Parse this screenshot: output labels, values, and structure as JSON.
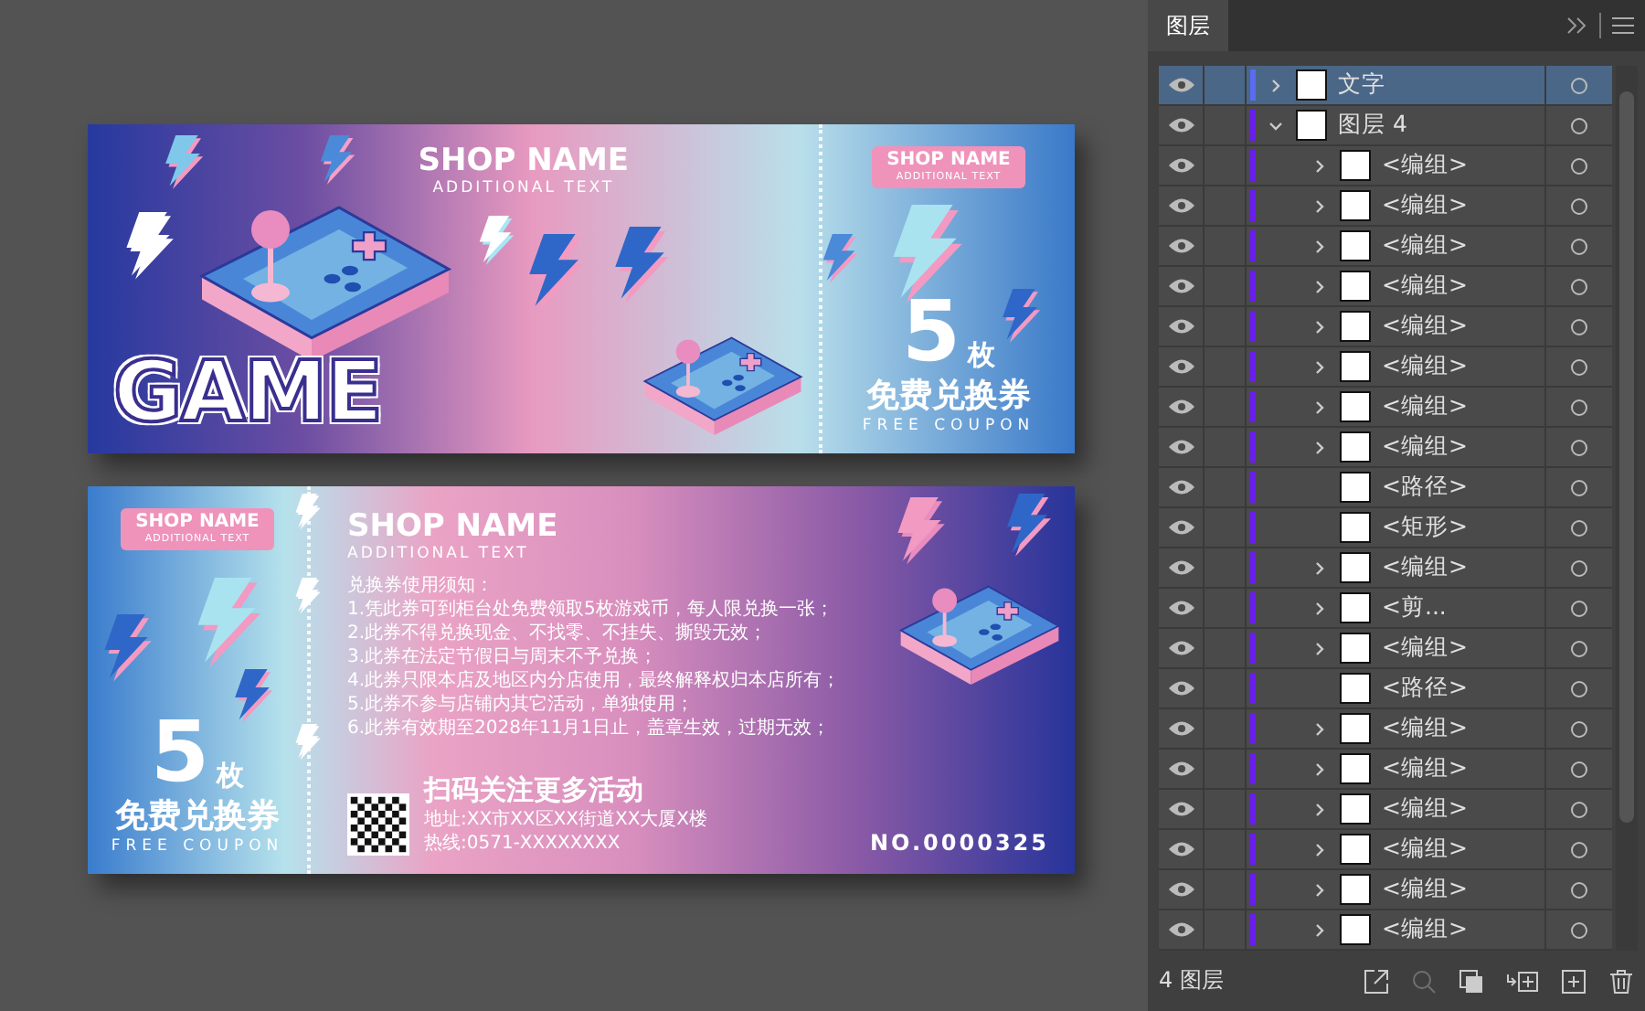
{
  "canvas": {
    "coupons": [
      {
        "kind": "stub-right",
        "shop_name": "SHOP NAME",
        "additional_text": "ADDITIONAL TEXT",
        "headline": "GAME",
        "stub": {
          "shop_name": "SHOP NAME",
          "additional_text": "ADDITIONAL TEXT",
          "count": "5",
          "unit": "枚",
          "title": "免费兑换券",
          "subtitle": "FREE COUPON"
        }
      },
      {
        "kind": "stub-left",
        "shop_name": "SHOP NAME",
        "additional_text": "ADDITIONAL TEXT",
        "stub": {
          "shop_name": "SHOP NAME",
          "additional_text": "ADDITIONAL TEXT",
          "count": "5",
          "unit": "枚",
          "title": "免费兑换券",
          "subtitle": "FREE COUPON"
        },
        "rules_title": "兑换券使用须知：",
        "rules": [
          "1.凭此券可到柜台处免费领取5枚游戏币，每人限兑换一张；",
          "2.此券不得兑换现金、不找零、不挂失、撕毁无效；",
          "3.此券在法定节假日与周末不予兑换；",
          "4.此券只限本店及地区内分店使用，最终解释权归本店所有；",
          "5.此券不参与店铺内其它活动，单独使用；",
          "6.此券有效期至2028年11月1日止，盖章生效，过期无效；"
        ],
        "qr_caption": "扫码关注更多活动",
        "address": "地址:XX市XX区XX街道XX大厦X楼",
        "hotline": "热线:0571-XXXXXXXX",
        "serial": "NO.0000325"
      }
    ]
  },
  "layers_panel": {
    "tab": {
      "label": "图层",
      "selected": true
    },
    "layers": [
      {
        "label": "文字",
        "kind": "group",
        "expanded": false,
        "selected": true,
        "visible": true,
        "color": "#5b6cf0"
      },
      {
        "label": "图层 4",
        "kind": "group",
        "expanded": true,
        "selected": false,
        "visible": true,
        "color": "#6a1df0",
        "children": [
          {
            "label": "<编组>",
            "kind": "group",
            "expanded": false,
            "selected": false,
            "visible": true
          },
          {
            "label": "<编组>",
            "kind": "group",
            "expanded": false,
            "selected": false,
            "visible": true
          },
          {
            "label": "<编组>",
            "kind": "group",
            "expanded": false,
            "selected": false,
            "visible": true
          },
          {
            "label": "<编组>",
            "kind": "group",
            "expanded": false,
            "selected": false,
            "visible": true
          },
          {
            "label": "<编组>",
            "kind": "group",
            "expanded": false,
            "selected": false,
            "visible": true
          },
          {
            "label": "<编组>",
            "kind": "group",
            "expanded": false,
            "selected": false,
            "visible": true
          },
          {
            "label": "<编组>",
            "kind": "group",
            "expanded": false,
            "selected": false,
            "visible": true
          },
          {
            "label": "<编组>",
            "kind": "group",
            "expanded": false,
            "selected": false,
            "visible": true
          },
          {
            "label": "<路径>",
            "kind": "shape",
            "selected": false,
            "visible": true
          },
          {
            "label": "<矩形>",
            "kind": "shape",
            "selected": false,
            "visible": true
          },
          {
            "label": "<编组>",
            "kind": "group",
            "expanded": false,
            "selected": false,
            "visible": true
          },
          {
            "label": "<剪...",
            "kind": "group",
            "expanded": false,
            "selected": false,
            "visible": true
          },
          {
            "label": "<编组>",
            "kind": "group",
            "expanded": false,
            "selected": false,
            "visible": true
          },
          {
            "label": "<路径>",
            "kind": "shape",
            "selected": false,
            "visible": true
          },
          {
            "label": "<编组>",
            "kind": "group",
            "expanded": false,
            "selected": false,
            "visible": true
          },
          {
            "label": "<编组>",
            "kind": "group",
            "expanded": false,
            "selected": false,
            "visible": true
          },
          {
            "label": "<编组>",
            "kind": "group",
            "expanded": false,
            "selected": false,
            "visible": true
          },
          {
            "label": "<编组>",
            "kind": "group",
            "expanded": false,
            "selected": false,
            "visible": true
          },
          {
            "label": "<编组>",
            "kind": "group",
            "expanded": false,
            "selected": false,
            "visible": true
          },
          {
            "label": "<编组>",
            "kind": "group",
            "expanded": false,
            "selected": false,
            "visible": true
          }
        ]
      }
    ],
    "count_label": "4 图层"
  }
}
